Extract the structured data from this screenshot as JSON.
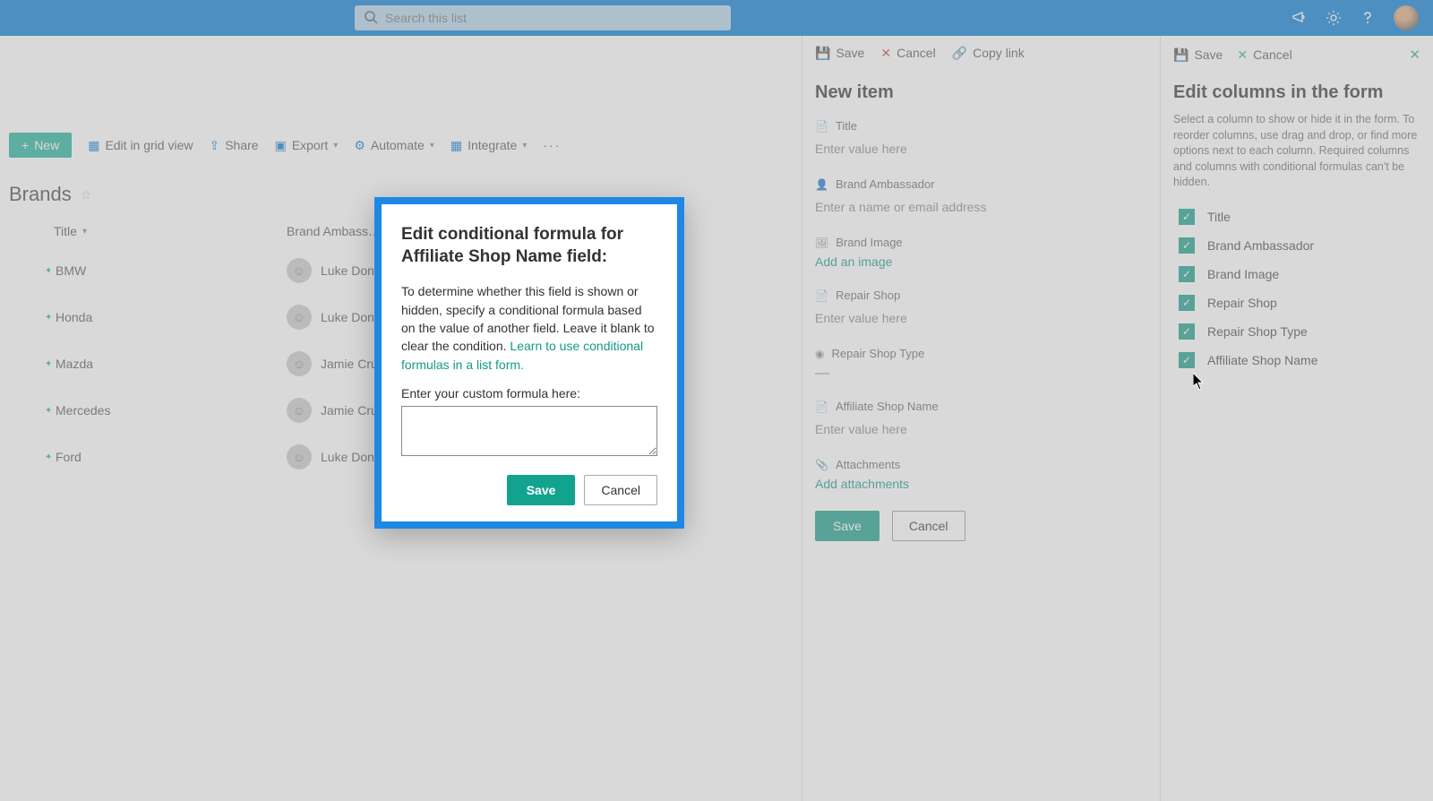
{
  "topbar": {
    "search_placeholder": "Search this list"
  },
  "cmd": {
    "new": "New",
    "edit_grid": "Edit in grid view",
    "share": "Share",
    "export": "Export",
    "automate": "Automate",
    "integrate": "Integrate"
  },
  "list": {
    "title": "Brands",
    "columns": {
      "title": "Title",
      "ambassador": "Brand Ambass…"
    },
    "rows": [
      {
        "title": "BMW",
        "ambassador": "Luke Donald"
      },
      {
        "title": "Honda",
        "ambassador": "Luke Donald"
      },
      {
        "title": "Mazda",
        "ambassador": "Jamie Crust"
      },
      {
        "title": "Mercedes",
        "ambassador": "Jamie Crust"
      },
      {
        "title": "Ford",
        "ambassador": "Luke Donald"
      }
    ]
  },
  "newitem": {
    "save": "Save",
    "cancel": "Cancel",
    "copy": "Copy link",
    "heading": "New item",
    "fields": {
      "title": {
        "label": "Title",
        "placeholder": "Enter value here"
      },
      "ambassador": {
        "label": "Brand Ambassador",
        "placeholder": "Enter a name or email address"
      },
      "image": {
        "label": "Brand Image",
        "action": "Add an image"
      },
      "repair": {
        "label": "Repair Shop",
        "placeholder": "Enter value here"
      },
      "repair_type": {
        "label": "Repair Shop Type",
        "value": "—"
      },
      "affiliate": {
        "label": "Affiliate Shop Name",
        "placeholder": "Enter value here"
      },
      "attachments": {
        "label": "Attachments",
        "action": "Add attachments"
      }
    },
    "btn_save": "Save",
    "btn_cancel": "Cancel"
  },
  "colspanel": {
    "save": "Save",
    "cancel": "Cancel",
    "heading": "Edit columns in the form",
    "desc": "Select a column to show or hide it in the form. To reorder columns, use drag and drop, or find more options next to each column. Required columns and columns with conditional formulas can't be hidden.",
    "items": [
      "Title",
      "Brand Ambassador",
      "Brand Image",
      "Repair Shop",
      "Repair Shop Type",
      "Affiliate Shop Name"
    ]
  },
  "modal": {
    "heading": "Edit conditional formula for Affiliate Shop Name field:",
    "body": "To determine whether this field is shown or hidden, specify a conditional formula based on the value of another field. Leave it blank to clear the condition.",
    "learn": "Learn to use conditional formulas in a list form.",
    "field_label": "Enter your custom formula here:",
    "save": "Save",
    "cancel": "Cancel"
  }
}
